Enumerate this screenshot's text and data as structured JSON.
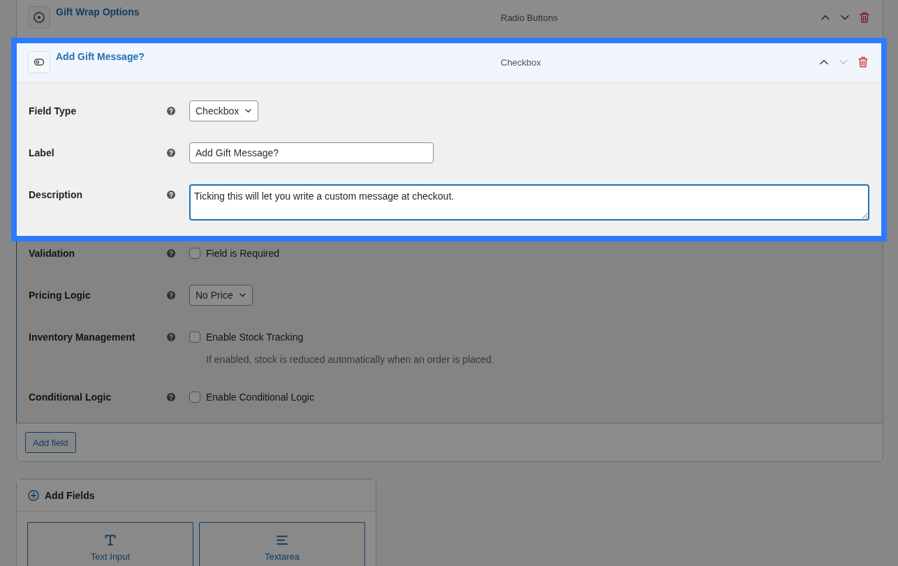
{
  "fields_card": {
    "fields": [
      {
        "kind": "radio",
        "title": "Gift Wrap Options",
        "type_label": "Radio Buttons",
        "highlighted": false,
        "expanded": false,
        "up_disabled": false,
        "down_disabled": false
      },
      {
        "kind": "checkbox",
        "title": "Add Gift Message?",
        "type_label": "Checkbox",
        "highlighted": true,
        "expanded": true,
        "up_disabled": false,
        "down_disabled": true,
        "settings": [
          {
            "kind": "select",
            "label": "Field Type",
            "value": "Checkbox",
            "focused": false,
            "highlighted": true
          },
          {
            "kind": "text",
            "label": "Label",
            "value": "Add Gift Message?",
            "focused": false,
            "highlighted": true
          },
          {
            "kind": "textarea",
            "label": "Description",
            "value": "Ticking this will let you write a custom message at checkout.",
            "focused": true,
            "highlighted": true
          },
          {
            "kind": "checkbox",
            "label": "Validation",
            "option": "Field is Required",
            "checked": false,
            "highlighted": false
          },
          {
            "kind": "select",
            "label": "Pricing Logic",
            "value": "No Price",
            "focused": false,
            "highlighted": false
          },
          {
            "kind": "checkbox",
            "label": "Inventory Management",
            "option": "Enable Stock Tracking",
            "checked": false,
            "hint": "If enabled, stock is reduced automatically when an order is placed.",
            "highlighted": false
          },
          {
            "kind": "checkbox",
            "label": "Conditional Logic",
            "option": "Enable Conditional Logic",
            "checked": false,
            "highlighted": false
          }
        ]
      }
    ],
    "add_field_button": "Add field"
  },
  "add_fields_panel": {
    "title": "Add Fields",
    "field_types": [
      {
        "kind": "text",
        "label": "Text Input"
      },
      {
        "kind": "textarea",
        "label": "Textarea"
      }
    ]
  }
}
